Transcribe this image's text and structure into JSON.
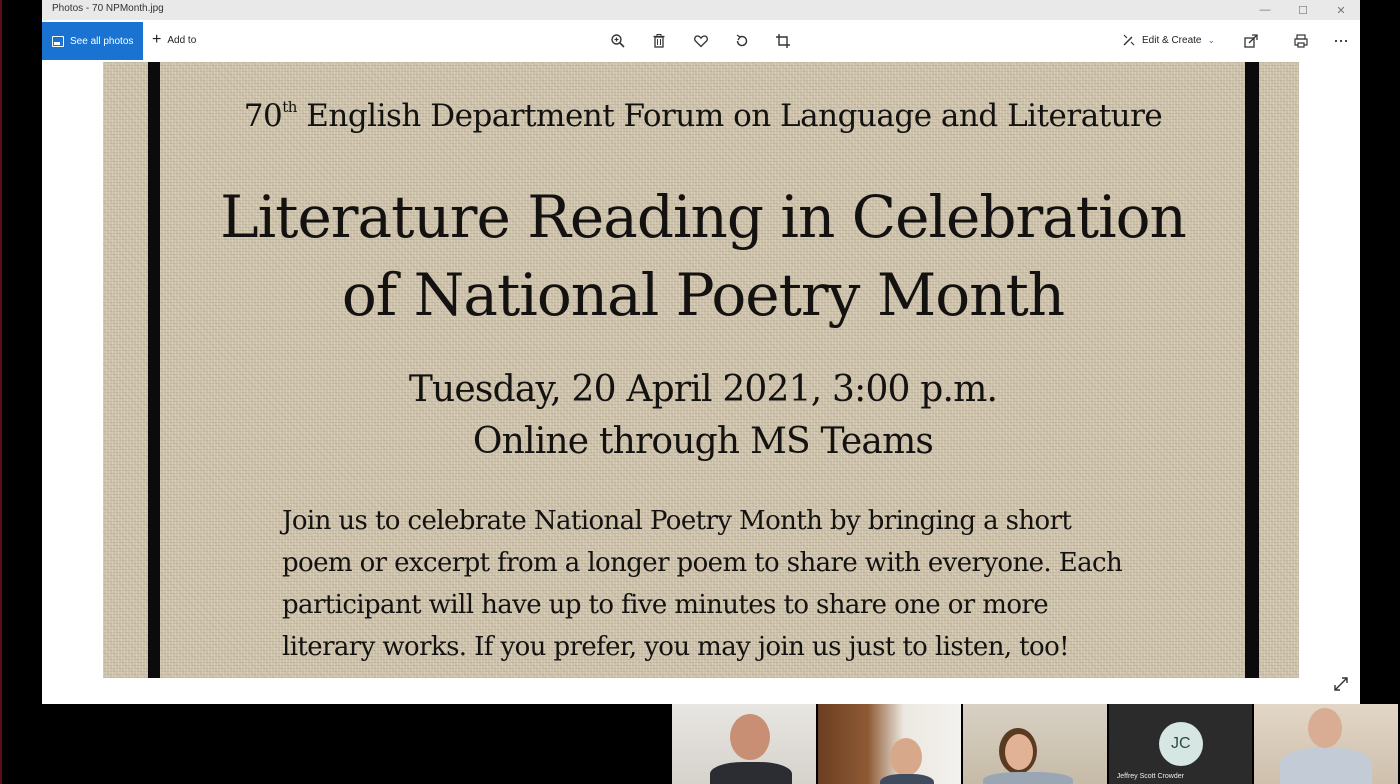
{
  "window": {
    "title": "Photos - 70 NPMonth.jpg",
    "controls": [
      "—",
      "☐",
      "✕"
    ]
  },
  "toolbar": {
    "see_all_label": "See all photos",
    "add_to_label": "Add to",
    "edit_create_label": "Edit & Create",
    "icons": [
      "zoom-icon",
      "delete-icon",
      "favorite-icon",
      "rotate-icon",
      "crop-icon",
      "share-icon",
      "print-icon",
      "more-icon"
    ]
  },
  "flyer": {
    "forum_ordinal": "70",
    "forum_superscript": "th",
    "forum_title": " English Department Forum on Language and Literature",
    "headline_line1": "Literature Reading in Celebration",
    "headline_line2": "of National Poetry Month",
    "date_line": "Tuesday, 20 April 2021, 3:00 p.m.",
    "venue_line": "Online through MS Teams",
    "body_line1": "Join us to celebrate National Poetry Month by bringing a short",
    "body_line2": "poem or excerpt from a longer poem to share with everyone.  Each",
    "body_line3": "participant will have up to five minutes to share one or more",
    "body_line4": "literary works.  If you prefer, you may join us just to listen, too!"
  },
  "participants": {
    "initials": "JC",
    "name": "Jeffrey Scott Crowder"
  },
  "colors": {
    "accent": "#1a73d0",
    "parchment": "#cfc4ae",
    "frame": "#0b0b0b"
  }
}
